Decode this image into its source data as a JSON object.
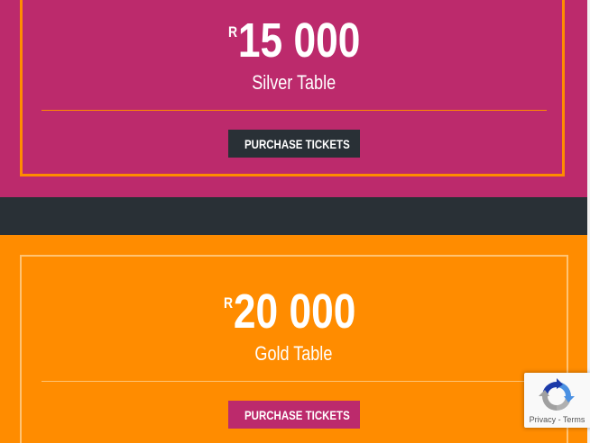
{
  "silver": {
    "currency": "R",
    "amount": "15 000",
    "name": "Silver Table",
    "button_label": "PURCHASE TICKETS"
  },
  "gold": {
    "currency": "R",
    "amount": "20 000",
    "name": "Gold Table",
    "button_label": "PURCHASE TICKETS"
  },
  "recaptcha": {
    "terms_text": "Privacy - Terms",
    "icon": "recaptcha-logo-icon"
  },
  "icons": {
    "ticket": "ticket-icon"
  },
  "colors": {
    "silver_bg": "#bc2a6c",
    "gold_bg": "#ff8c00",
    "dark_band": "#293036",
    "silver_frame": "#ff8c00",
    "gold_frame": "#ffc373"
  }
}
